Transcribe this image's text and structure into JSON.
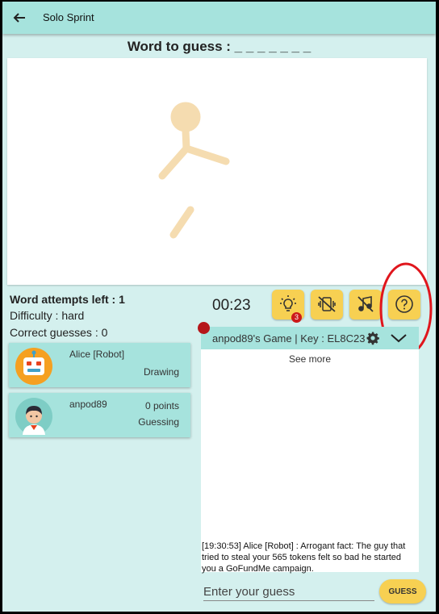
{
  "appbar": {
    "title": "Solo Sprint"
  },
  "word": {
    "label": "Word to guess : _ _ _ _ _ _ _"
  },
  "stats": {
    "attempts": "Word attempts left :  1",
    "difficulty": "Difficulty :  hard",
    "correct": "Correct guesses :  0"
  },
  "players": [
    {
      "name": "Alice [Robot]",
      "status": "Drawing",
      "avatar": "robot-avatar-icon"
    },
    {
      "name": "anpod89",
      "points": "0 points",
      "status": "Guessing",
      "avatar": "boy-avatar-icon"
    }
  ],
  "timer": "00:23",
  "tools": {
    "hint_count": "3",
    "icons": [
      "hint-bulb-icon",
      "no-vibration-icon",
      "music-off-icon",
      "help-question-icon"
    ]
  },
  "game": {
    "name": "anpod89's Game  | Key :  EL8C23"
  },
  "chat": {
    "see_more": "See more",
    "message": "[19:30:53] Alice [Robot] : Arrogant fact: The guy that tried to steal your 565 tokens felt so bad he started you a GoFundMe campaign."
  },
  "guess": {
    "placeholder": "Enter your guess",
    "button": "GUESS"
  },
  "colors": {
    "background": "#d4f0ee",
    "appbar": "#a6e3dd",
    "accent": "#f7d052",
    "sketch": "#f5dcb0",
    "highlight": "#e0161d"
  }
}
